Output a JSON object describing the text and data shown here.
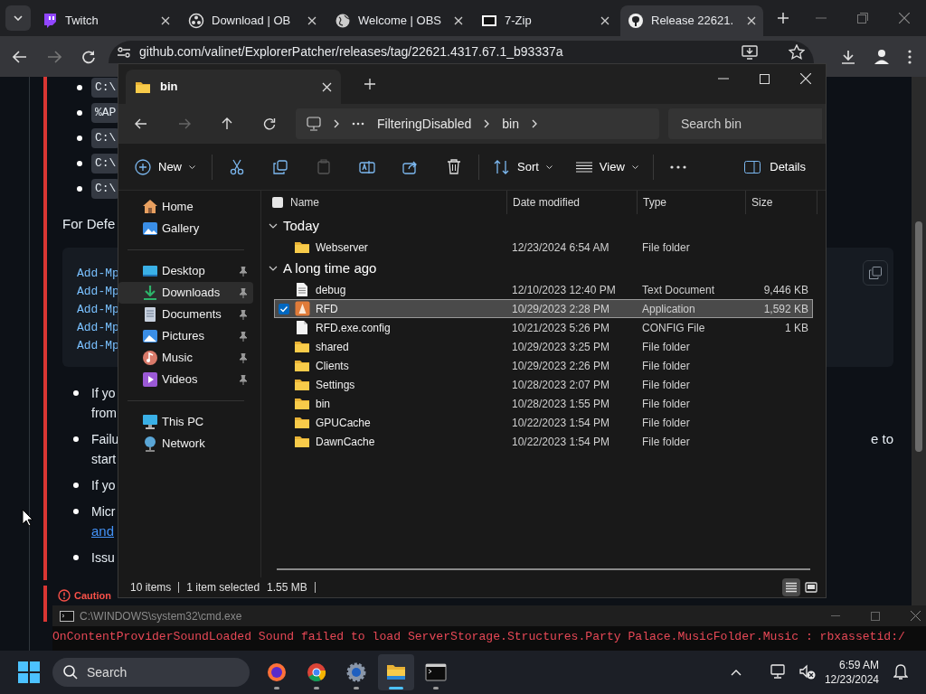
{
  "browser": {
    "tabs": [
      {
        "label": "Twitch",
        "kind": "twitch",
        "selected": false
      },
      {
        "label": "Download | OB",
        "kind": "obs",
        "selected": false
      },
      {
        "label": "Welcome | OBS",
        "kind": "globe",
        "selected": false
      },
      {
        "label": "7-Zip",
        "kind": "zip",
        "selected": false
      },
      {
        "label": "Release 22621.",
        "kind": "github",
        "selected": true
      }
    ],
    "address": "github.com/valinet/ExplorerPatcher/releases/tag/22621.4317.67.1_b93337a",
    "page": {
      "code_items": [
        "C:\\",
        "%AP",
        "C:\\",
        "C:\\",
        "C:\\"
      ],
      "paragraph": "For Defe",
      "code_block": [
        "Add-Mp",
        "Add-Mp",
        "Add-Mp",
        "Add-Mp",
        "Add-Mp"
      ],
      "bullets": [
        {
          "lines": [
            {
              "text": "If yo",
              "kind": "text"
            },
            {
              "text": "from",
              "kind": "text"
            }
          ]
        },
        {
          "lines": [
            {
              "text": "Failu",
              "kind": "text"
            },
            {
              "text": "start",
              "kind": "text"
            }
          ],
          "tail": "e to"
        },
        {
          "lines": [
            {
              "text": "If yo",
              "kind": "text"
            }
          ]
        },
        {
          "lines": [
            {
              "text": "Micr",
              "kind": "text"
            },
            {
              "text": "and",
              "kind": "link"
            }
          ]
        },
        {
          "lines": [
            {
              "text": "Issu",
              "kind": "text"
            }
          ]
        }
      ],
      "callout": {
        "title": "Caution"
      }
    }
  },
  "explorer": {
    "tab": "bin",
    "breadcrumb": [
      "FilteringDisabled",
      "bin"
    ],
    "search": {
      "placeholder": "Search bin"
    },
    "toolbar": {
      "new": "New",
      "sort": "Sort",
      "view": "View",
      "details": "Details"
    },
    "nav": [
      [
        {
          "label": "Home",
          "kind": "home",
          "pinned": false,
          "selected": false
        },
        {
          "label": "Gallery",
          "kind": "gallery",
          "pinned": false,
          "selected": false
        }
      ],
      [
        {
          "label": "Desktop",
          "kind": "desktop",
          "pinned": true,
          "selected": false
        },
        {
          "label": "Downloads",
          "kind": "downloads",
          "pinned": true,
          "selected": true
        },
        {
          "label": "Documents",
          "kind": "documents",
          "pinned": true,
          "selected": false
        },
        {
          "label": "Pictures",
          "kind": "pictures",
          "pinned": true,
          "selected": false
        },
        {
          "label": "Music",
          "kind": "music",
          "pinned": true,
          "selected": false
        },
        {
          "label": "Videos",
          "kind": "videos",
          "pinned": true,
          "selected": false
        }
      ],
      [
        {
          "label": "This PC",
          "kind": "pc",
          "pinned": false,
          "selected": false
        },
        {
          "label": "Network",
          "kind": "network",
          "pinned": false,
          "selected": false
        }
      ]
    ],
    "select_all": {
      "checked": false
    },
    "columns": [
      "Name",
      "Date modified",
      "Type",
      "Size"
    ],
    "groups": [
      {
        "title": "Today",
        "expanded": true,
        "files": [
          {
            "name": "Webserver",
            "date": "12/23/2024 6:54 AM",
            "type": "File folder",
            "kind": "folder",
            "selected": false
          }
        ]
      },
      {
        "title": "A long time ago",
        "expanded": true,
        "files": [
          {
            "name": "debug",
            "date": "12/10/2023 12:40 PM",
            "type": "Text Document",
            "size": "9,446 KB",
            "kind": "text",
            "selected": false
          },
          {
            "name": "RFD",
            "date": "10/29/2023 2:28 PM",
            "type": "Application",
            "size": "1,592 KB",
            "kind": "app",
            "selected": true
          },
          {
            "name": "RFD.exe.config",
            "date": "10/21/2023 5:26 PM",
            "type": "CONFIG File",
            "size": "1 KB",
            "kind": "config",
            "selected": false
          },
          {
            "name": "shared",
            "date": "10/29/2023 3:25 PM",
            "type": "File folder",
            "kind": "folder",
            "selected": false
          },
          {
            "name": "Clients",
            "date": "10/29/2023 2:26 PM",
            "type": "File folder",
            "kind": "folder",
            "selected": false
          },
          {
            "name": "Settings",
            "date": "10/28/2023 2:07 PM",
            "type": "File folder",
            "kind": "folder",
            "selected": false
          },
          {
            "name": "bin",
            "date": "10/28/2023 1:55 PM",
            "type": "File folder",
            "kind": "folder",
            "selected": false
          },
          {
            "name": "GPUCache",
            "date": "10/22/2023 1:54 PM",
            "type": "File folder",
            "kind": "folder",
            "selected": false
          },
          {
            "name": "DawnCache",
            "date": "10/22/2023 1:54 PM",
            "type": "File folder",
            "kind": "folder",
            "selected": false
          }
        ]
      }
    ],
    "status": {
      "count": "10 items",
      "selection": "1 item selected",
      "size": "1.55 MB"
    },
    "views": [
      {
        "kind": "details",
        "selected": true
      },
      {
        "kind": "tiles",
        "selected": false
      }
    ]
  },
  "cmd": {
    "title": "C:\\WINDOWS\\system32\\cmd.exe",
    "line": "OnContentProviderSoundLoaded Sound failed to load ServerStorage.Structures.Party Palace.MusicFolder.Music : rbxassetid:/"
  },
  "taskbar": {
    "search": "Search",
    "apps": [
      {
        "kind": "firefox",
        "selected": false
      },
      {
        "kind": "chrome",
        "selected": false
      },
      {
        "kind": "settings",
        "selected": false
      },
      {
        "kind": "explorer",
        "selected": true
      },
      {
        "kind": "terminal",
        "selected": false
      }
    ],
    "time": "6:59 AM",
    "date": "12/23/2024"
  }
}
